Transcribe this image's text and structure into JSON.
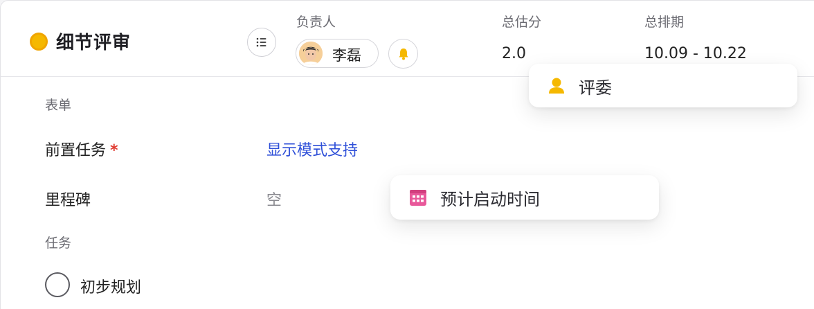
{
  "header": {
    "status_color": "#f5b800",
    "title": "细节评审",
    "list_icon": "list-icon",
    "owner": {
      "label": "负责人",
      "name": "李磊",
      "bell_icon": "bell-icon"
    },
    "estimate": {
      "label": "总估分",
      "value": "2.0"
    },
    "schedule": {
      "label": "总排期",
      "value": "10.09 - 10.22"
    }
  },
  "form": {
    "section_label": "表单",
    "rows": [
      {
        "label": "前置任务",
        "required": "*",
        "value": "显示模式支持"
      },
      {
        "label": "里程碑",
        "value": "空"
      }
    ]
  },
  "tasks": {
    "section_label": "任务",
    "items": [
      {
        "label": "初步规划",
        "done": false
      }
    ]
  },
  "popovers": {
    "reviewer": {
      "icon": "person-icon",
      "icon_color": "#f5b800",
      "label": "评委"
    },
    "start_time": {
      "icon": "calendar-icon",
      "icon_color": "#e8589a",
      "label": "预计启动时间"
    }
  },
  "colors": {
    "link": "#2f50d8",
    "required": "#e03a2f"
  }
}
